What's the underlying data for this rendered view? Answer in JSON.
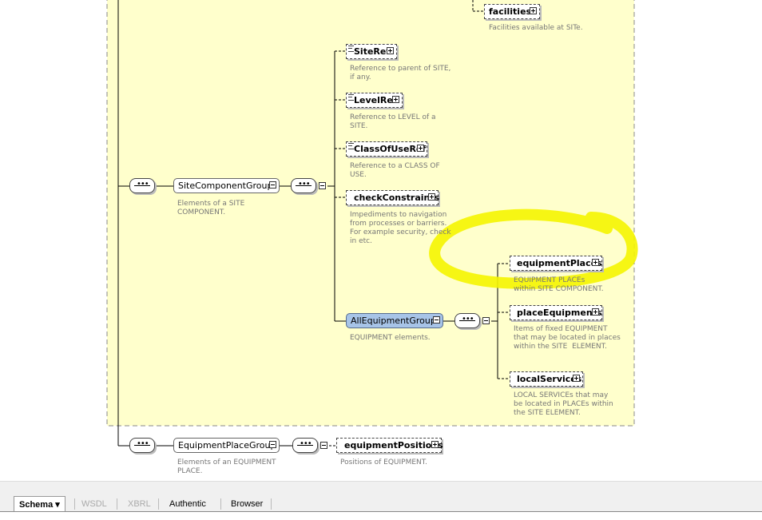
{
  "diagram": {
    "nodes": {
      "facilities": {
        "label": "facilities",
        "desc": "Facilities available at SITe."
      },
      "site_ref": {
        "label": "SiteRef",
        "desc": "Reference to parent of SITE,\nif any."
      },
      "level_ref": {
        "label": "LevelRef",
        "desc": "Reference to LEVEL of a\nSITE."
      },
      "class_of_use_ref": {
        "label": "ClassOfUseRef",
        "desc": "Reference to a CLASS OF\nUSE."
      },
      "check_constraints": {
        "label": "checkConstraints",
        "desc": "Impediments to navigation\nfrom processes or barriers.\nFor example security, check\nin etc."
      },
      "site_component_group": {
        "label": "SiteComponentGroup",
        "desc": "Elements of a SITE\nCOMPONENT."
      },
      "all_equipment_group": {
        "label": "AllEquipmentGroup",
        "desc": "EQUIPMENT elements."
      },
      "equipment_places": {
        "label": "equipmentPlaces",
        "desc": "EQUIPMENT PLACEs\nwithin SITE COMPONENT."
      },
      "place_equipments": {
        "label": "placeEquipments",
        "desc": "Items of fixed EQUIPMENT\nthat may be located in places\nwithin the SITE  ELEMENT."
      },
      "local_services": {
        "label": "localServices",
        "desc": "LOCAL SERVICEs that may\nbe located in PLACEs within\nthe SITE ELEMENT."
      },
      "equipment_place_group": {
        "label": "EquipmentPlaceGroup",
        "desc": "Elements of an EQUIPMENT\nPLACE."
      },
      "equipment_positions": {
        "label": "equipmentPositions",
        "desc": "Positions of EQUIPMENT."
      }
    },
    "colors": {
      "group_bg": "#ffffcc",
      "highlight": "#f5f500",
      "selected_node": "#a7c4e8"
    }
  },
  "tabs": {
    "schema": "Schema ▾",
    "wsdl": "WSDL",
    "xbrl": "XBRL",
    "authentic": "Authentic",
    "browser": "Browser"
  }
}
